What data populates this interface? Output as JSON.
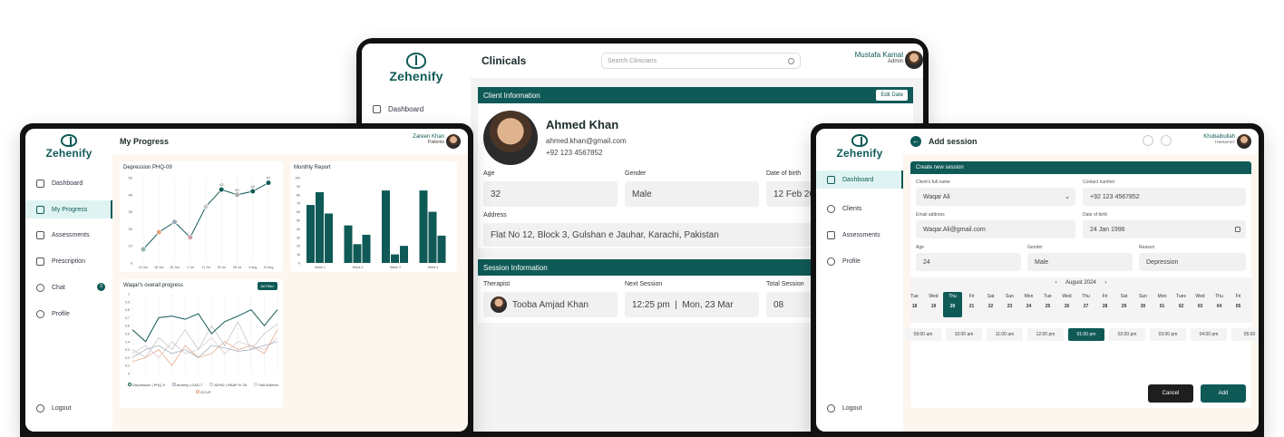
{
  "brand": "Zehenify",
  "clinicals": {
    "title": "Clinicals",
    "search_placeholder": "Search Clinicians",
    "user": {
      "name": "Mustafa Kamal",
      "role": "Admin"
    },
    "nav": {
      "dashboard": "Dashboard"
    },
    "client_info": {
      "header": "Client Information",
      "edit_label": "Edit Date",
      "name": "Ahmed Khan",
      "email": "ahmed.khan@gmail.com",
      "phone": "+92 123 4567852",
      "age_label": "Age",
      "age": "32",
      "gender_label": "Gender",
      "gender": "Male",
      "dob_label": "Date of birth",
      "dob": "12 Feb 20",
      "address_label": "Address",
      "address": "Flat No 12, Block 3, Gulshan e Jauhar, Karachi, Pakistan"
    },
    "session_info": {
      "header": "Session Information",
      "therapist_label": "Therapist",
      "therapist": "Tooba Amjad Khan",
      "next_label": "Next Session",
      "next": "12:25 pm  |  Mon, 23 Mar",
      "total_label": "Total Session",
      "total": "08"
    }
  },
  "progress": {
    "title": "My Progress",
    "user": {
      "name": "Zareen Khan",
      "role": "Patients"
    },
    "nav": [
      "Dashboard",
      "My Progress",
      "Assessments",
      "Prescription",
      "Chat",
      "Profile"
    ],
    "chat_badge": "3",
    "logout": "Logout",
    "phq_title": "Depression PHQ-09",
    "monthly_title": "Monthly Report",
    "overall_title": "Waqar's overall progress",
    "overall_button": "All Filter",
    "legend": [
      "Depression | PHQ-9",
      "Anxiety | GAD-7",
      "ADHD | SNAP IV 26",
      "Self-Esteem",
      "OCI-R"
    ]
  },
  "chart_data": [
    {
      "type": "line",
      "title": "Depression PHQ-09",
      "categories": [
        "13 Jun",
        "18 Jun",
        "28 Jun",
        "2 Jul",
        "11 Jul",
        "20 Jul",
        "28 Jul",
        "3 Aug",
        "10 Aug"
      ],
      "values": [
        8,
        18,
        24,
        15,
        33,
        43,
        40,
        42,
        47
      ],
      "yticks": [
        "0",
        "10",
        "20",
        "30",
        "40",
        "50"
      ],
      "ylim": [
        0,
        50
      ]
    },
    {
      "type": "bar",
      "title": "Monthly Report",
      "categories": [
        "Week 1",
        "Week 2",
        "Week 3",
        "Week 4"
      ],
      "series_values": [
        [
          68,
          83,
          58
        ],
        [
          44,
          22,
          33
        ],
        [
          85,
          10,
          20
        ],
        [
          85,
          60,
          32
        ]
      ],
      "yticks": [
        "0",
        "10",
        "20",
        "30",
        "40",
        "50",
        "60",
        "70",
        "80",
        "90",
        "100"
      ],
      "ylim": [
        0,
        100
      ]
    },
    {
      "type": "line",
      "title": "Waqar's overall progress",
      "yticks": [
        "0",
        "0.1",
        "0.2",
        "0.3",
        "0.4",
        "0.5",
        "0.6",
        "0.7",
        "0.8",
        "0.9",
        "1"
      ],
      "ylim": [
        0,
        1
      ],
      "series": [
        {
          "name": "Depression | PHQ-9",
          "color": "#0f5a57",
          "values": [
            0.55,
            0.4,
            0.7,
            0.72,
            0.68,
            0.75,
            0.5,
            0.65,
            0.72,
            0.8,
            0.6,
            0.8
          ]
        },
        {
          "name": "Anxiety | GAD-7",
          "color": "#9aa6b8",
          "values": [
            0.2,
            0.3,
            0.35,
            0.25,
            0.3,
            0.2,
            0.35,
            0.32,
            0.28,
            0.3,
            0.35,
            0.4
          ]
        },
        {
          "name": "ADHD | SNAP IV 26",
          "color": "#bfbfbf",
          "values": [
            0.3,
            0.2,
            0.45,
            0.3,
            0.55,
            0.3,
            0.6,
            0.35,
            0.65,
            0.3,
            0.5,
            0.62
          ]
        },
        {
          "name": "Self-Esteem",
          "color": "#d9c2cc",
          "values": [
            0.25,
            0.35,
            0.2,
            0.4,
            0.25,
            0.3,
            0.45,
            0.25,
            0.4,
            0.35,
            0.3,
            0.45
          ]
        },
        {
          "name": "OCI-R",
          "color": "#e3a07a",
          "values": [
            0.15,
            0.2,
            0.3,
            0.1,
            0.35,
            0.2,
            0.25,
            0.4,
            0.3,
            0.35,
            0.25,
            0.55
          ]
        }
      ]
    }
  ],
  "session": {
    "title": "Add session",
    "user": {
      "name": "Khubaibullah",
      "role": "THERAPIST"
    },
    "nav": [
      "Dashboard",
      "Clients",
      "Assessments",
      "Profile"
    ],
    "logout": "Logout",
    "form_header": "Create new session",
    "name_label": "Client's full name",
    "name": "Waqar Ali",
    "contact_label": "Contact number",
    "contact": "+92 123 4567852",
    "email_label": "Email address",
    "email": "Waqar.Ali@gmail.com",
    "dob_label": "Date of birth",
    "dob": "24 Jan 1996",
    "age_label": "Age",
    "age": "24",
    "gender_label": "Gender",
    "gender": "Male",
    "reason_label": "Reason",
    "reason": "Depression",
    "month": "August 2024",
    "days": [
      {
        "d": "Tue",
        "n": "18"
      },
      {
        "d": "Wed",
        "n": "19"
      },
      {
        "d": "Thu",
        "n": "20"
      },
      {
        "d": "Fri",
        "n": "21"
      },
      {
        "d": "Sat",
        "n": "22"
      },
      {
        "d": "Sun",
        "n": "23"
      },
      {
        "d": "Mon",
        "n": "24"
      },
      {
        "d": "Tue",
        "n": "25"
      },
      {
        "d": "Wed",
        "n": "26"
      },
      {
        "d": "Thu",
        "n": "27"
      },
      {
        "d": "Fri",
        "n": "28"
      },
      {
        "d": "Sat",
        "n": "29"
      },
      {
        "d": "Sun",
        "n": "30"
      },
      {
        "d": "Mon",
        "n": "01"
      },
      {
        "d": "Tues",
        "n": "02"
      },
      {
        "d": "Wed",
        "n": "03"
      },
      {
        "d": "Thu",
        "n": "04"
      },
      {
        "d": "Fri",
        "n": "05"
      }
    ],
    "selected_day": "20",
    "times": [
      "09:00 am",
      "10:00 am",
      "11:00 am",
      "12:00 pm",
      "01:00 pm",
      "02:00 pm",
      "03:00 pm",
      "04:00 pm",
      "05:00"
    ],
    "selected_time": "01:00 pm",
    "cancel": "Cancel",
    "add": "Add"
  }
}
